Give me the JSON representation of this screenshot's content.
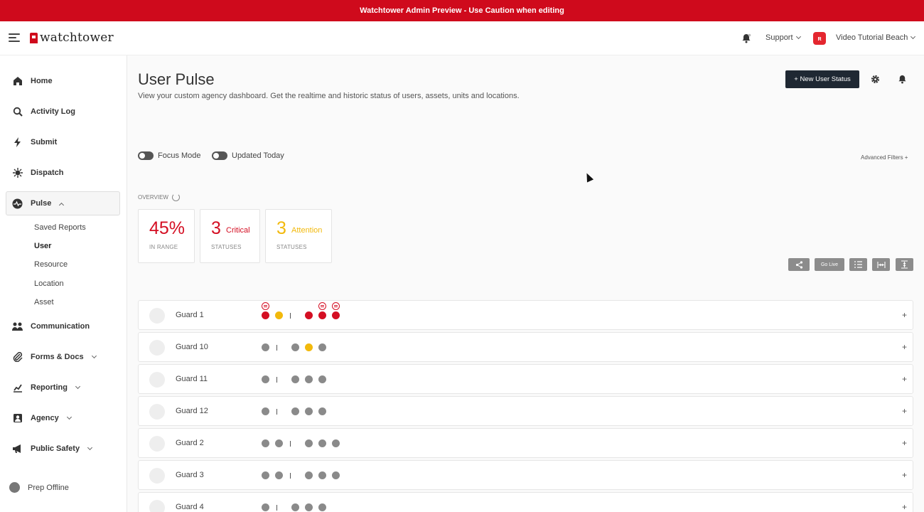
{
  "banner": {
    "text": "Watchtower Admin Preview - Use Caution when editing"
  },
  "header": {
    "logo_text": "watchtower",
    "support_label": "Support",
    "user_initial": "ʀ",
    "user_name": "Video Tutorial Beach",
    "bell_icon": "bell-icon"
  },
  "sidebar": {
    "items": [
      {
        "label": "Home",
        "icon": "home-icon"
      },
      {
        "label": "Activity Log",
        "icon": "search-icon"
      },
      {
        "label": "Submit",
        "icon": "bolt-icon"
      },
      {
        "label": "Dispatch",
        "icon": "dispatch-icon"
      },
      {
        "label": "Pulse",
        "icon": "pulse-icon"
      },
      {
        "label": "Communication",
        "icon": "people-icon"
      },
      {
        "label": "Forms & Docs",
        "icon": "paperclip-icon"
      },
      {
        "label": "Reporting",
        "icon": "chart-icon"
      },
      {
        "label": "Agency",
        "icon": "badge-icon"
      },
      {
        "label": "Public Safety",
        "icon": "megaphone-icon"
      }
    ],
    "pulse_sub": [
      "Saved Reports",
      "User",
      "Resource",
      "Location",
      "Asset"
    ],
    "prep_offline": "Prep Offline"
  },
  "main": {
    "title": "User Pulse",
    "subtitle": "View your custom agency dashboard. Get the realtime and historic status of users, assets, units and locations.",
    "new_button": "+   New User Status",
    "focus_mode": "Focus Mode",
    "updated_today": "Updated Today",
    "advanced_filters": "Advanced Filters +",
    "overview_label": "OVERVIEW",
    "cards": [
      {
        "value": "45%",
        "label": "IN RANGE",
        "severity": ""
      },
      {
        "value": "3",
        "label": "STATUSES",
        "severity": "Critical"
      },
      {
        "value": "3",
        "label": "STATUSES",
        "severity": "Attention"
      }
    ],
    "toolbar": {
      "go_live": "Go Live"
    },
    "colors": {
      "critical": "#d40f23",
      "attention": "#f2b90c",
      "neutral": "#8a8a8a"
    },
    "rows": [
      {
        "name": "Guard 1"
      },
      {
        "name": "Guard 10"
      },
      {
        "name": "Guard 11"
      },
      {
        "name": "Guard 12"
      },
      {
        "name": "Guard 2"
      },
      {
        "name": "Guard 3"
      },
      {
        "name": "Guard 4"
      }
    ],
    "row_expand": "+"
  }
}
